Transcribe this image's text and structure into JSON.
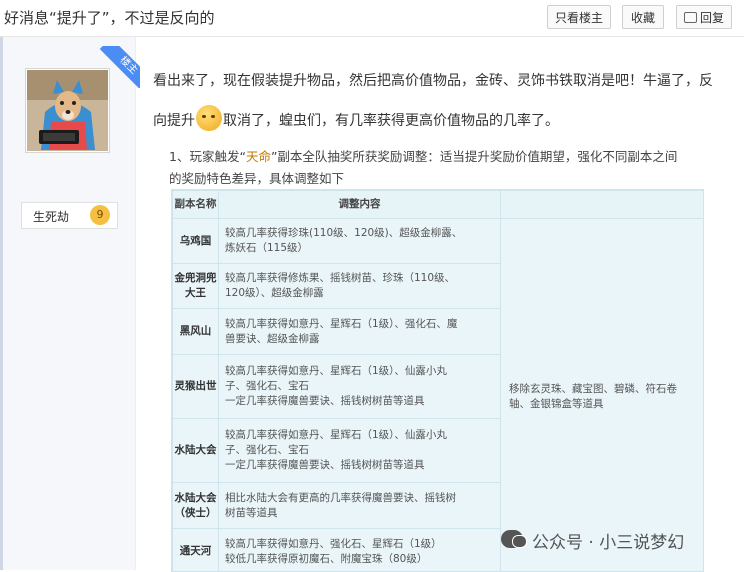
{
  "thread": {
    "title": "好消息“提升了”，不过是反向的",
    "buttons": {
      "only_op": "只看楼主",
      "favorite": "收藏",
      "reply": "回复"
    }
  },
  "author": {
    "badge": "楼主",
    "name": "生死劫",
    "level": "9"
  },
  "post": {
    "line1": "看出来了，现在假装提升物品，然后把高价值物品，金砖、灵饰书铁取消是吧！牛逼了，反",
    "line2_before": "向提升",
    "line2_after": "取消了，蝗虫们，有几率获得更高价值物品的几率了。",
    "adjust_prefix": "1、玩家触发“",
    "adjust_highlight": "天命",
    "adjust_suffix": "”副本全队抽奖所获奖励调整：适当提升奖励价值期望，强化不同副本之间",
    "adjust_line2": "的奖励特色差异，具体调整如下"
  },
  "table": {
    "headers": [
      "副本名称",
      "调整内容"
    ],
    "rows": [
      {
        "name": "乌鸡国",
        "content": [
          "较高几率获得珍珠(110级、120级)、超级金柳露、",
          "炼妖石（115级）"
        ]
      },
      {
        "name": "金兜洞兜大王",
        "content": [
          "较高几率获得修炼果、摇钱树苗、珍珠（110级、",
          "120级）、超级金柳露"
        ]
      },
      {
        "name": "黑风山",
        "content": [
          "较高几率获得如意丹、星辉石（1级）、强化石、魔",
          "兽要诀、超级金柳露"
        ]
      },
      {
        "name": "灵猴出世",
        "content": [
          "较高几率获得如意丹、星辉石（1级）、仙露小丸",
          "子、强化石、宝石",
          "一定几率获得魔兽要诀、摇钱树树苗等道具"
        ]
      },
      {
        "name": "水陆大会",
        "content": [
          "较高几率获得如意丹、星辉石（1级）、仙露小丸",
          "子、强化石、宝石",
          "一定几率获得魔兽要诀、摇钱树树苗等道具"
        ]
      },
      {
        "name": "水陆大会（侠士）",
        "content": [
          "相比水陆大会有更高的几率获得魔兽要诀、摇钱树",
          "树苗等道具"
        ]
      },
      {
        "name": "通天河",
        "content": [
          "较高几率获得如意丹、强化石、星辉石（1级）",
          "较低几率获得原初魔石、附魔宝珠（80级）"
        ]
      }
    ],
    "extra_content": [
      "移除玄灵珠、藏宝图、碧磷、符石卷",
      "轴、金银锦盒等道具"
    ]
  },
  "watermark": "公众号 · 小三说梦幻"
}
